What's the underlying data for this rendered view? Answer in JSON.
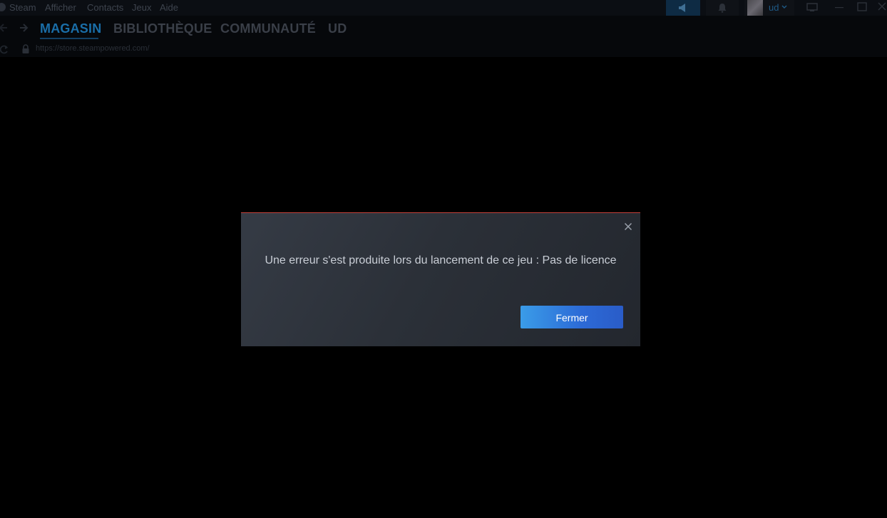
{
  "menubar": {
    "items": [
      "Steam",
      "Afficher",
      "Contacts",
      "Jeux",
      "Aide"
    ],
    "username": "ud"
  },
  "nav": {
    "tabs": [
      "MAGASIN",
      "BIBLIOTHÈQUE",
      "COMMUNAUTÉ",
      "UD"
    ],
    "active_tab": "MAGASIN"
  },
  "urlbar": {
    "url": "https://store.steampowered.com/"
  },
  "dialog": {
    "message": "Une erreur s'est produite lors du lancement de ce jeu : Pas de licence",
    "button_label": "Fermer"
  },
  "colors": {
    "accent": "#1a6ea8",
    "dialog_border_top": "#c4413a",
    "button_start": "#3a9ce8",
    "button_end": "#2a5cc8"
  },
  "icons": {
    "back": "arrow-left-icon",
    "forward": "arrow-right-icon",
    "reload": "reload-icon",
    "lock": "lock-icon",
    "announce": "megaphone-icon",
    "notifications": "bell-icon",
    "close": "close-icon"
  }
}
